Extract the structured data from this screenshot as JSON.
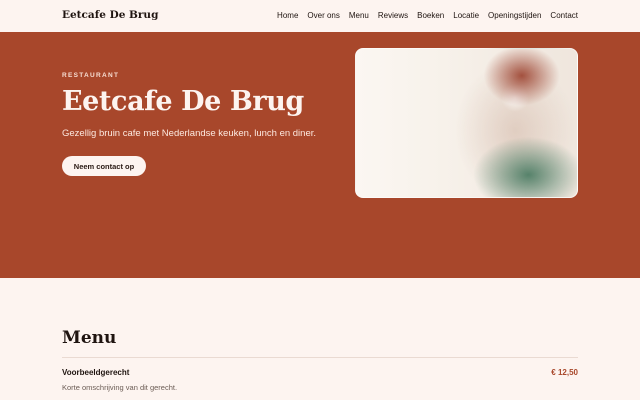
{
  "header": {
    "brand": "Eetcafe De Brug",
    "nav": [
      "Home",
      "Over ons",
      "Menu",
      "Reviews",
      "Boeken",
      "Locatie",
      "Openingstijden",
      "Contact"
    ]
  },
  "hero": {
    "eyebrow": "RESTAURANT",
    "title": "Eetcafe De Brug",
    "tagline": "Gezellig bruin cafe met Nederlandse keuken, lunch en diner.",
    "cta_label": "Neem contact op"
  },
  "menu": {
    "title": "Menu",
    "items": [
      {
        "name": "Voorbeeldgerecht",
        "price": "€ 12,50",
        "description": "Korte omschrijving van dit gerecht."
      }
    ]
  },
  "colors": {
    "hero_background": "#a8472b",
    "page_background": "#fdf4f0",
    "price_accent": "#a8472b"
  }
}
